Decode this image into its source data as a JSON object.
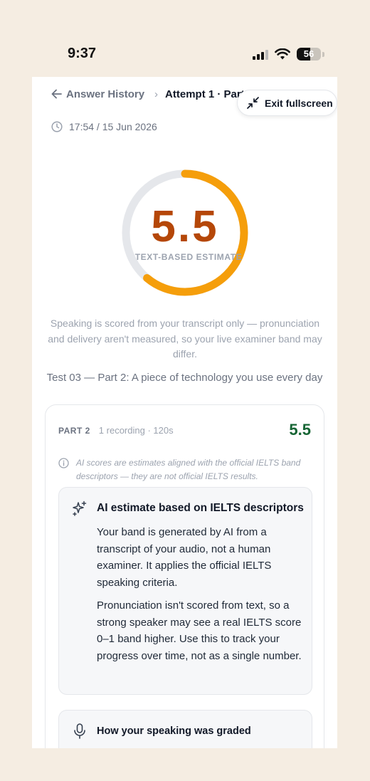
{
  "status_bar": {
    "time": "9:37",
    "battery_percent": "56",
    "battery_level": 0.56
  },
  "breadcrumb": {
    "back_label": "Answer History",
    "current": "Attempt 1 · Part 2"
  },
  "exit_fullscreen_label": "Exit fullscreen",
  "timestamp": "17:54 / 15 Jun 2026",
  "score": {
    "value": "5.5",
    "max_band": 9,
    "band": 5.5,
    "caption": "TEXT-BASED ESTIMATE",
    "progress_color": "#f59e0b",
    "track_color": "#e5e7eb"
  },
  "disclaimer": "Speaking is scored from your transcript only — pronunciation and delivery aren't measured, so your live examiner band may differ.",
  "test_title": "Test 03 — Part 2: A piece of technology you use every day",
  "part_card": {
    "part_label": "PART 2",
    "meta": "1 recording · 120s",
    "score": "5.5",
    "ai_note": "AI scores are estimates aligned with the official IELTS band descriptors — they are not official IELTS results.",
    "info": {
      "title": "AI estimate based on IELTS descriptors",
      "paragraph_1": "Your band is generated by AI from a transcript of your audio, not a human examiner. It applies the official IELTS speaking criteria.",
      "paragraph_2": "Pronunciation isn't scored from text, so a strong speaker may see a real IELTS score 0–1 band higher. Use this to track your progress over time, not as a single number."
    },
    "graded_title": "How your speaking was graded"
  }
}
